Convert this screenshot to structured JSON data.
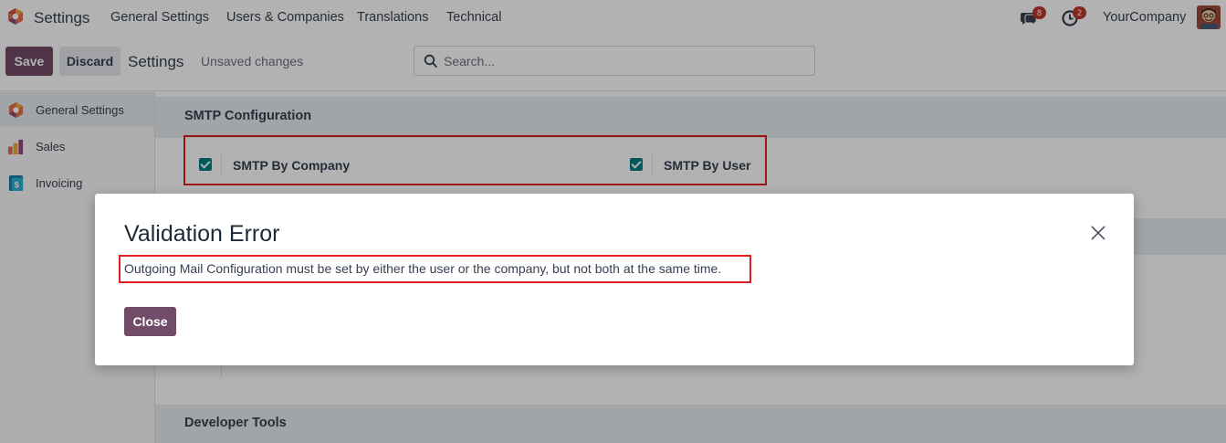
{
  "navbar": {
    "app_name": "Settings",
    "menu": [
      "General Settings",
      "Users & Companies",
      "Translations",
      "Technical"
    ],
    "messages_badge": "8",
    "activities_badge": "2",
    "company": "YourCompany"
  },
  "control_panel": {
    "save_label": "Save",
    "discard_label": "Discard",
    "title": "Settings",
    "status": "Unsaved changes",
    "search_placeholder": "Search..."
  },
  "sidebar": {
    "items": [
      {
        "label": "General Settings",
        "icon": "settings-app-icon",
        "active": true
      },
      {
        "label": "Sales",
        "icon": "sales-app-icon",
        "active": false
      },
      {
        "label": "Invoicing",
        "icon": "invoicing-app-icon",
        "active": false
      }
    ]
  },
  "main": {
    "smtp_section_title": "SMTP Configuration",
    "smtp_by_company_label": "SMTP By Company",
    "smtp_by_company_checked": true,
    "smtp_by_user_label": "SMTP By User",
    "smtp_by_user_checked": true,
    "developer_section_title": "Developer Tools"
  },
  "dialog": {
    "title": "Validation Error",
    "message": "Outgoing Mail Configuration must be set by either the user or the company, but not both at the same time.",
    "close_label": "Close"
  },
  "colors": {
    "primary": "#714b67",
    "checkbox": "#017e84",
    "badge": "#c0392b",
    "highlight": "#e02020"
  }
}
